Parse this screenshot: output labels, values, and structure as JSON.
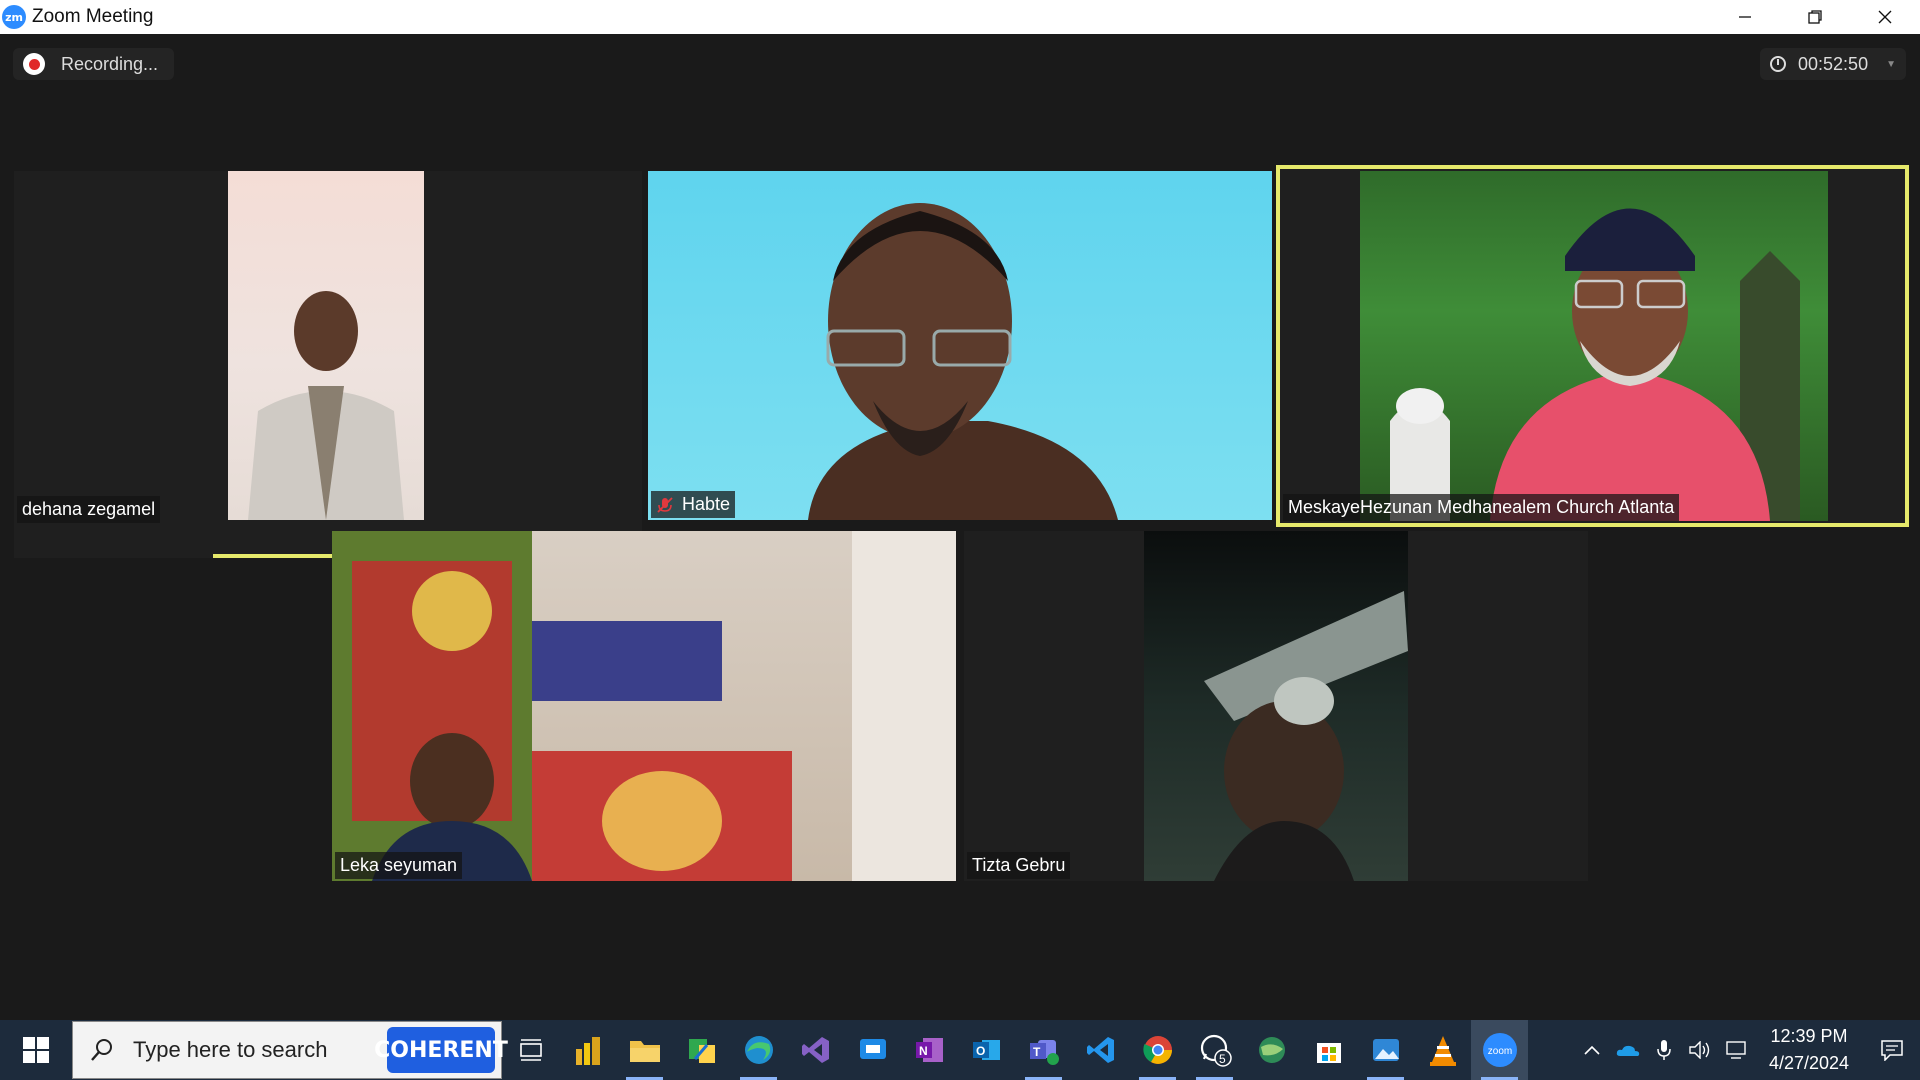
{
  "window": {
    "title": "Zoom Meeting",
    "logo": "zm"
  },
  "meeting": {
    "recording_label": "Recording...",
    "timer": "00:52:50",
    "active_speaker_color": "#e6e96b",
    "participants": [
      {
        "name": "dehana zegamel",
        "muted": false
      },
      {
        "name": "Habte",
        "muted": true
      },
      {
        "name": "MeskayeHezunan Medhanealem Church Atlanta",
        "muted": false
      },
      {
        "name": "Leka seyuman",
        "muted": false
      },
      {
        "name": "Tizta Gebru",
        "muted": false
      }
    ]
  },
  "taskbar": {
    "search_placeholder": "Type here to search",
    "search_badge": "COHERENT",
    "whatsapp_badge": "5",
    "zoom_label": "zoom",
    "clock_time": "12:39 PM",
    "clock_date": "4/27/2024",
    "apps": [
      "task-view-icon",
      "power-bi-icon",
      "file-explorer-icon",
      "project-icon",
      "edge-icon",
      "visual-studio-icon",
      "remote-desktop-icon",
      "onenote-icon",
      "outlook-icon",
      "teams-icon",
      "vscode-icon",
      "chrome-icon",
      "whatsapp-icon",
      "globe-icon",
      "store-icon",
      "photos-icon",
      "vlc-icon",
      "zoom-icon"
    ]
  }
}
